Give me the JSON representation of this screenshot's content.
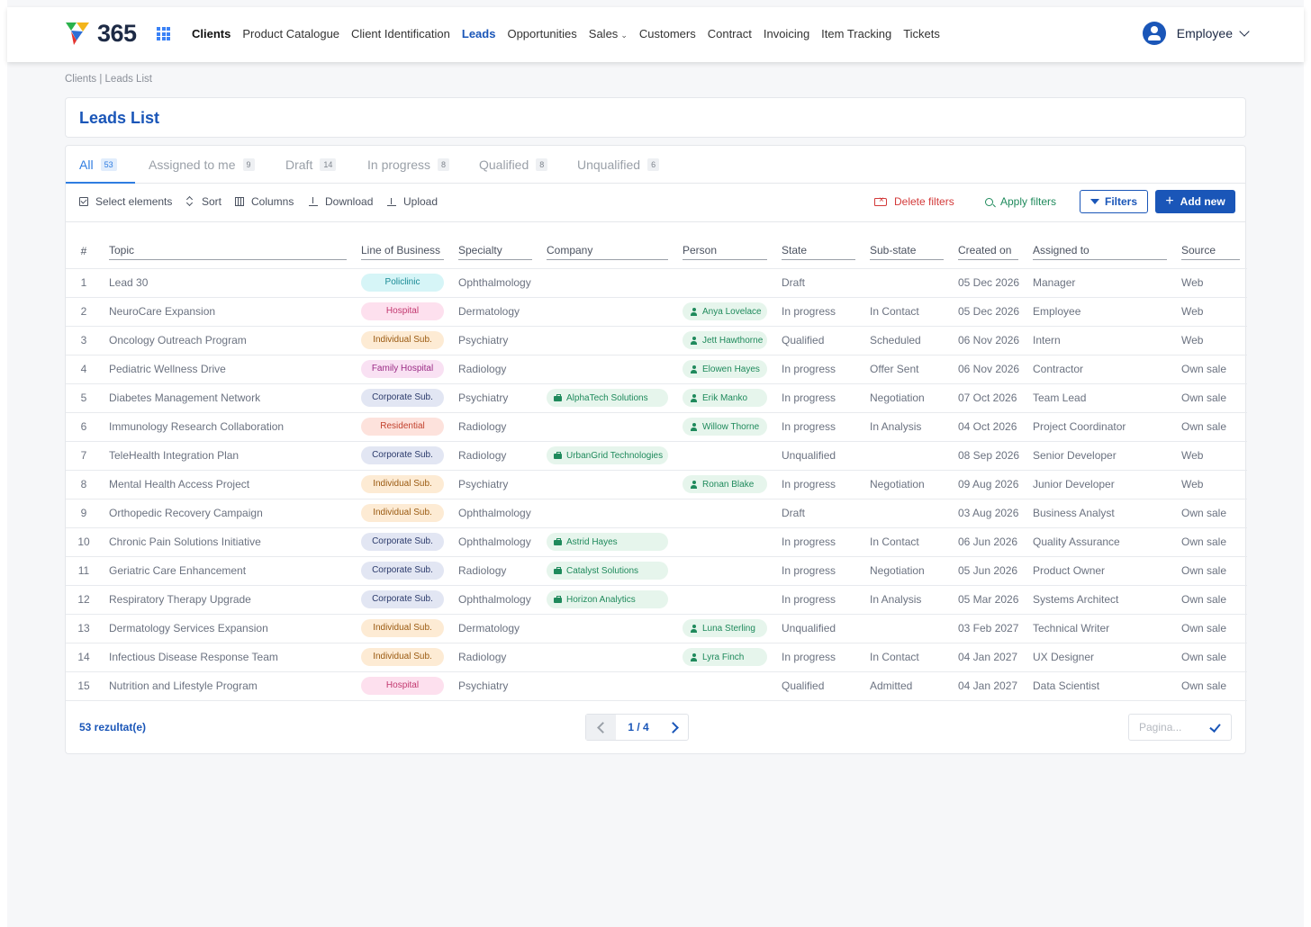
{
  "brand": {
    "logo_text": "365"
  },
  "nav": [
    {
      "label": "Clients",
      "state": "bold"
    },
    {
      "label": "Product Catalogue",
      "state": ""
    },
    {
      "label": "Client Identification",
      "state": ""
    },
    {
      "label": "Leads",
      "state": "active"
    },
    {
      "label": "Opportunities",
      "state": ""
    },
    {
      "label": "Sales",
      "state": "",
      "caret": true
    },
    {
      "label": "Customers",
      "state": ""
    },
    {
      "label": "Contract",
      "state": ""
    },
    {
      "label": "Invoicing",
      "state": ""
    },
    {
      "label": "Item Tracking",
      "state": ""
    },
    {
      "label": "Tickets",
      "state": ""
    }
  ],
  "user": {
    "name": "Employee"
  },
  "breadcrumb": "Clients | Leads List",
  "page_title": "Leads List",
  "tabs": [
    {
      "label": "All",
      "count": "53"
    },
    {
      "label": "Assigned to me",
      "count": "9"
    },
    {
      "label": "Draft",
      "count": "14"
    },
    {
      "label": "In progress",
      "count": "8"
    },
    {
      "label": "Qualified",
      "count": "8"
    },
    {
      "label": "Unqualified",
      "count": "6"
    }
  ],
  "toolbar": {
    "select_label": "Select elements",
    "sort_label": "Sort",
    "columns_label": "Columns",
    "download_label": "Download",
    "upload_label": "Upload",
    "delete_filters_label": "Delete filters",
    "apply_filters_label": "Apply filters",
    "filters_label": "Filters",
    "add_new_label": "Add new"
  },
  "table": {
    "headers": [
      "#",
      "Topic",
      "Line of Business",
      "Specialty",
      "Company",
      "Person",
      "State",
      "Sub-state",
      "Created on",
      "Assigned to",
      "Source"
    ],
    "rows": [
      {
        "n": "1",
        "topic": "Lead 30",
        "lob": "Policlinic",
        "specialty": "Ophthalmology",
        "company": "",
        "person": "",
        "state": "Draft",
        "substate": "",
        "created": "05 Dec 2026",
        "assigned": "Manager",
        "source": "Web"
      },
      {
        "n": "2",
        "topic": "NeuroCare Expansion",
        "lob": "Hospital",
        "specialty": "Dermatology",
        "company": "",
        "person": "Anya Lovelace",
        "state": "In progress",
        "substate": "In Contact",
        "created": "05 Dec 2026",
        "assigned": "Employee",
        "source": "Web"
      },
      {
        "n": "3",
        "topic": "Oncology Outreach Program",
        "lob": "Individual Sub.",
        "specialty": "Psychiatry",
        "company": "",
        "person": "Jett Hawthorne",
        "state": "Qualified",
        "substate": "Scheduled",
        "created": "06 Nov 2026",
        "assigned": "Intern",
        "source": "Web"
      },
      {
        "n": "4",
        "topic": "Pediatric Wellness Drive",
        "lob": "Family Hospital",
        "specialty": "Radiology",
        "company": "",
        "person": "Elowen Hayes",
        "state": "In progress",
        "substate": "Offer Sent",
        "created": "06 Nov 2026",
        "assigned": "Contractor",
        "source": "Own sale"
      },
      {
        "n": "5",
        "topic": "Diabetes Management Network",
        "lob": "Corporate Sub.",
        "specialty": "Psychiatry",
        "company": "AlphaTech Solutions",
        "person": "Erik Manko",
        "state": "In progress",
        "substate": "Negotiation",
        "created": "07 Oct 2026",
        "assigned": "Team Lead",
        "source": "Own sale"
      },
      {
        "n": "6",
        "topic": "Immunology Research Collaboration",
        "lob": "Residential",
        "specialty": "Radiology",
        "company": "",
        "person": "Willow Thorne",
        "state": "In progress",
        "substate": "In Analysis",
        "created": "04 Oct 2026",
        "assigned": "Project Coordinator",
        "source": "Own sale"
      },
      {
        "n": "7",
        "topic": "TeleHealth Integration Plan",
        "lob": "Corporate Sub.",
        "specialty": "Radiology",
        "company": "UrbanGrid Technologies",
        "person": "",
        "state": "Unqualified",
        "substate": "",
        "created": "08 Sep 2026",
        "assigned": "Senior Developer",
        "source": "Web"
      },
      {
        "n": "8",
        "topic": "Mental Health Access Project",
        "lob": "Individual Sub.",
        "specialty": "Psychiatry",
        "company": "",
        "person": "Ronan Blake",
        "state": "In progress",
        "substate": "Negotiation",
        "created": "09 Aug 2026",
        "assigned": "Junior Developer",
        "source": "Web"
      },
      {
        "n": "9",
        "topic": "Orthopedic Recovery Campaign",
        "lob": "Individual Sub.",
        "specialty": "Ophthalmology",
        "company": "",
        "person": "",
        "state": "Draft",
        "substate": "",
        "created": "03 Aug 2026",
        "assigned": "Business Analyst",
        "source": "Own sale"
      },
      {
        "n": "10",
        "topic": "Chronic Pain Solutions Initiative",
        "lob": "Corporate Sub.",
        "specialty": "Ophthalmology",
        "company": "Astrid Hayes",
        "person": "",
        "state": "In progress",
        "substate": "In Contact",
        "created": "06 Jun 2026",
        "assigned": "Quality Assurance",
        "source": "Own sale"
      },
      {
        "n": "11",
        "topic": "Geriatric Care Enhancement",
        "lob": "Corporate Sub.",
        "specialty": "Radiology",
        "company": "Catalyst Solutions",
        "person": "",
        "state": "In progress",
        "substate": "Negotiation",
        "created": "05 Jun 2026",
        "assigned": "Product Owner",
        "source": "Own sale"
      },
      {
        "n": "12",
        "topic": "Respiratory Therapy Upgrade",
        "lob": "Corporate Sub.",
        "specialty": "Ophthalmology",
        "company": "Horizon Analytics",
        "person": "",
        "state": "In progress",
        "substate": "In Analysis",
        "created": "05 Mar 2026",
        "assigned": "Systems Architect",
        "source": "Own sale"
      },
      {
        "n": "13",
        "topic": "Dermatology Services Expansion",
        "lob": "Individual Sub.",
        "specialty": "Dermatology",
        "company": "",
        "person": "Luna Sterling",
        "state": "Unqualified",
        "substate": "",
        "created": "03 Feb 2027",
        "assigned": "Technical Writer",
        "source": "Own sale"
      },
      {
        "n": "14",
        "topic": "Infectious Disease Response Team",
        "lob": "Individual Sub.",
        "specialty": "Radiology",
        "company": "",
        "person": "Lyra Finch",
        "state": "In progress",
        "substate": "In Contact",
        "created": "04 Jan 2027",
        "assigned": "UX Designer",
        "source": "Own sale"
      },
      {
        "n": "15",
        "topic": "Nutrition and Lifestyle Program",
        "lob": "Hospital",
        "specialty": "Psychiatry",
        "company": "",
        "person": "",
        "state": "Qualified",
        "substate": "Admitted",
        "created": "04 Jan 2027",
        "assigned": "Data Scientist",
        "source": "Own sale"
      }
    ]
  },
  "footer": {
    "results": "53 rezultat(e)",
    "page_indicator": "1 / 4",
    "page_input_placeholder": "Pagina..."
  },
  "colors": {
    "primary": "#1a56b8",
    "tab_active": "#2f7de1",
    "danger": "#d33a3a",
    "success": "#1f8a5c"
  }
}
